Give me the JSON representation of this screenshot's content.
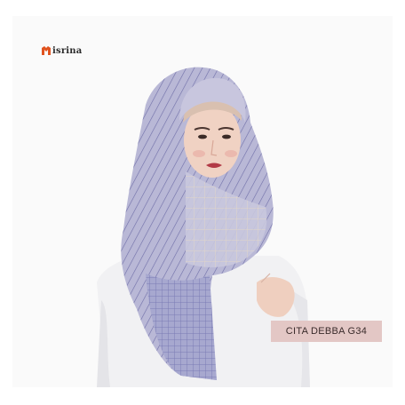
{
  "brand": {
    "name": "isrina",
    "mark_color": "#e0531f"
  },
  "product": {
    "label": "CITA DEBBA G34",
    "tag_color": "#e3c7c5"
  },
  "photo": {
    "subject": "model-wearing-lavender-plaid-hijab"
  }
}
